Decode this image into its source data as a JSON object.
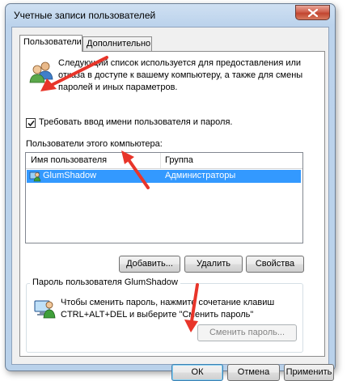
{
  "window": {
    "title": "Учетные записи пользователей",
    "close_glyph": "×"
  },
  "tabs": [
    {
      "label": "Пользователи",
      "active": true
    },
    {
      "label": "Дополнительно",
      "active": false
    }
  ],
  "users_tab": {
    "description": "Следующий список используется для предоставления или отказа в доступе к вашему компьютеру, а также для смены паролей и иных параметров.",
    "require_login_label": "Требовать ввод имени пользователя и пароля.",
    "require_login_checked": true,
    "users_list_label": "Пользователи этого компьютера:",
    "columns": [
      "Имя пользователя",
      "Группа"
    ],
    "rows": [
      {
        "name": "GlumShadow",
        "group": "Администраторы",
        "selected": true
      }
    ],
    "buttons": {
      "add": "Добавить...",
      "remove": "Удалить",
      "properties": "Свойства"
    },
    "password_group": {
      "title": "Пароль пользователя GlumShadow",
      "text": "Чтобы сменить пароль, нажмите сочетание клавиш CTRL+ALT+DEL и выберите \"Сменить пароль\"",
      "change_button": "Сменить пароль..."
    }
  },
  "footer": {
    "ok": "ОК",
    "cancel": "Отмена",
    "apply": "Применить"
  },
  "colors": {
    "selection": "#3399ff",
    "annotation_arrow": "#e8352a"
  },
  "icons": [
    "users-icon",
    "user-row-icon",
    "password-user-icon",
    "close-icon",
    "check-icon"
  ]
}
